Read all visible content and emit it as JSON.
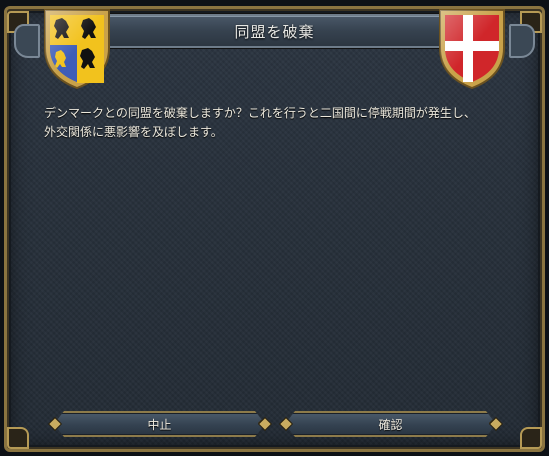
{
  "dialog": {
    "title": "同盟を破棄",
    "message_line1": "デンマークとの同盟を破棄しますか？これを行うと二国間に停戦期間が発生し、",
    "message_line2": "外交関係に悪影響を及ぼします。"
  },
  "buttons": {
    "cancel_label": "中止",
    "confirm_label": "確認"
  },
  "shields": {
    "left": {
      "icon": "heraldic-lions-coat-of-arms",
      "colors": [
        "#f2c21d",
        "#3e5db8",
        "#1a1a1a"
      ]
    },
    "right": {
      "icon": "danish-cross-coat-of-arms",
      "colors": [
        "#d0262a",
        "#ffffff"
      ]
    }
  },
  "theme": {
    "frame_gold": "#8a7440",
    "panel_bg": "#27303b",
    "text": "#ece8dc"
  }
}
